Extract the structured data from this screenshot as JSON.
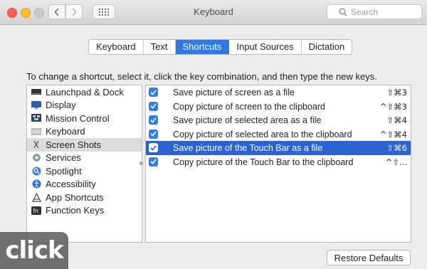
{
  "window": {
    "title": "Keyboard"
  },
  "toolbar": {
    "back_icon": "chevron-left-icon",
    "forward_icon": "chevron-right-icon",
    "grid_icon": "grid-icon",
    "search_placeholder": "Search"
  },
  "tabs": [
    {
      "label": "Keyboard",
      "active": false
    },
    {
      "label": "Text",
      "active": false
    },
    {
      "label": "Shortcuts",
      "active": true
    },
    {
      "label": "Input Sources",
      "active": false
    },
    {
      "label": "Dictation",
      "active": false
    }
  ],
  "instructions": "To change a shortcut, select it, click the key combination, and then type the new keys.",
  "categories": [
    {
      "label": "Launchpad & Dock",
      "icon": "launchpad-icon",
      "selected": false
    },
    {
      "label": "Display",
      "icon": "display-icon",
      "selected": false
    },
    {
      "label": "Mission Control",
      "icon": "mission-control-icon",
      "selected": false
    },
    {
      "label": "Keyboard",
      "icon": "keyboard-icon",
      "selected": false
    },
    {
      "label": "Screen Shots",
      "icon": "screenshot-icon",
      "selected": true
    },
    {
      "label": "Services",
      "icon": "gear-icon",
      "selected": false
    },
    {
      "label": "Spotlight",
      "icon": "spotlight-icon",
      "selected": false
    },
    {
      "label": "Accessibility",
      "icon": "accessibility-icon",
      "selected": false
    },
    {
      "label": "App Shortcuts",
      "icon": "app-store-icon",
      "selected": false
    },
    {
      "label": "Function Keys",
      "icon": "fn-key-icon",
      "selected": false
    }
  ],
  "shortcuts": [
    {
      "label": "Save picture of screen as a file",
      "key": "⇧⌘3",
      "checked": true,
      "selected": false
    },
    {
      "label": "Copy picture of screen to the clipboard",
      "key": "^⇧⌘3",
      "checked": true,
      "selected": false
    },
    {
      "label": "Save picture of selected area as a file",
      "key": "⇧⌘4",
      "checked": true,
      "selected": false
    },
    {
      "label": "Copy picture of selected area to the clipboard",
      "key": "^⇧⌘4",
      "checked": true,
      "selected": false
    },
    {
      "label": "Save picture of the Touch Bar as a file",
      "key": "⇧⌘6",
      "checked": true,
      "selected": true
    },
    {
      "label": "Copy picture of the Touch Bar to the clipboard",
      "key": "^⇧...",
      "checked": true,
      "selected": false
    }
  ],
  "restore_button": "Restore Defaults",
  "watermark": "click",
  "colors": {
    "accent": "#2f7ae6",
    "selection": "#2b63d3"
  }
}
